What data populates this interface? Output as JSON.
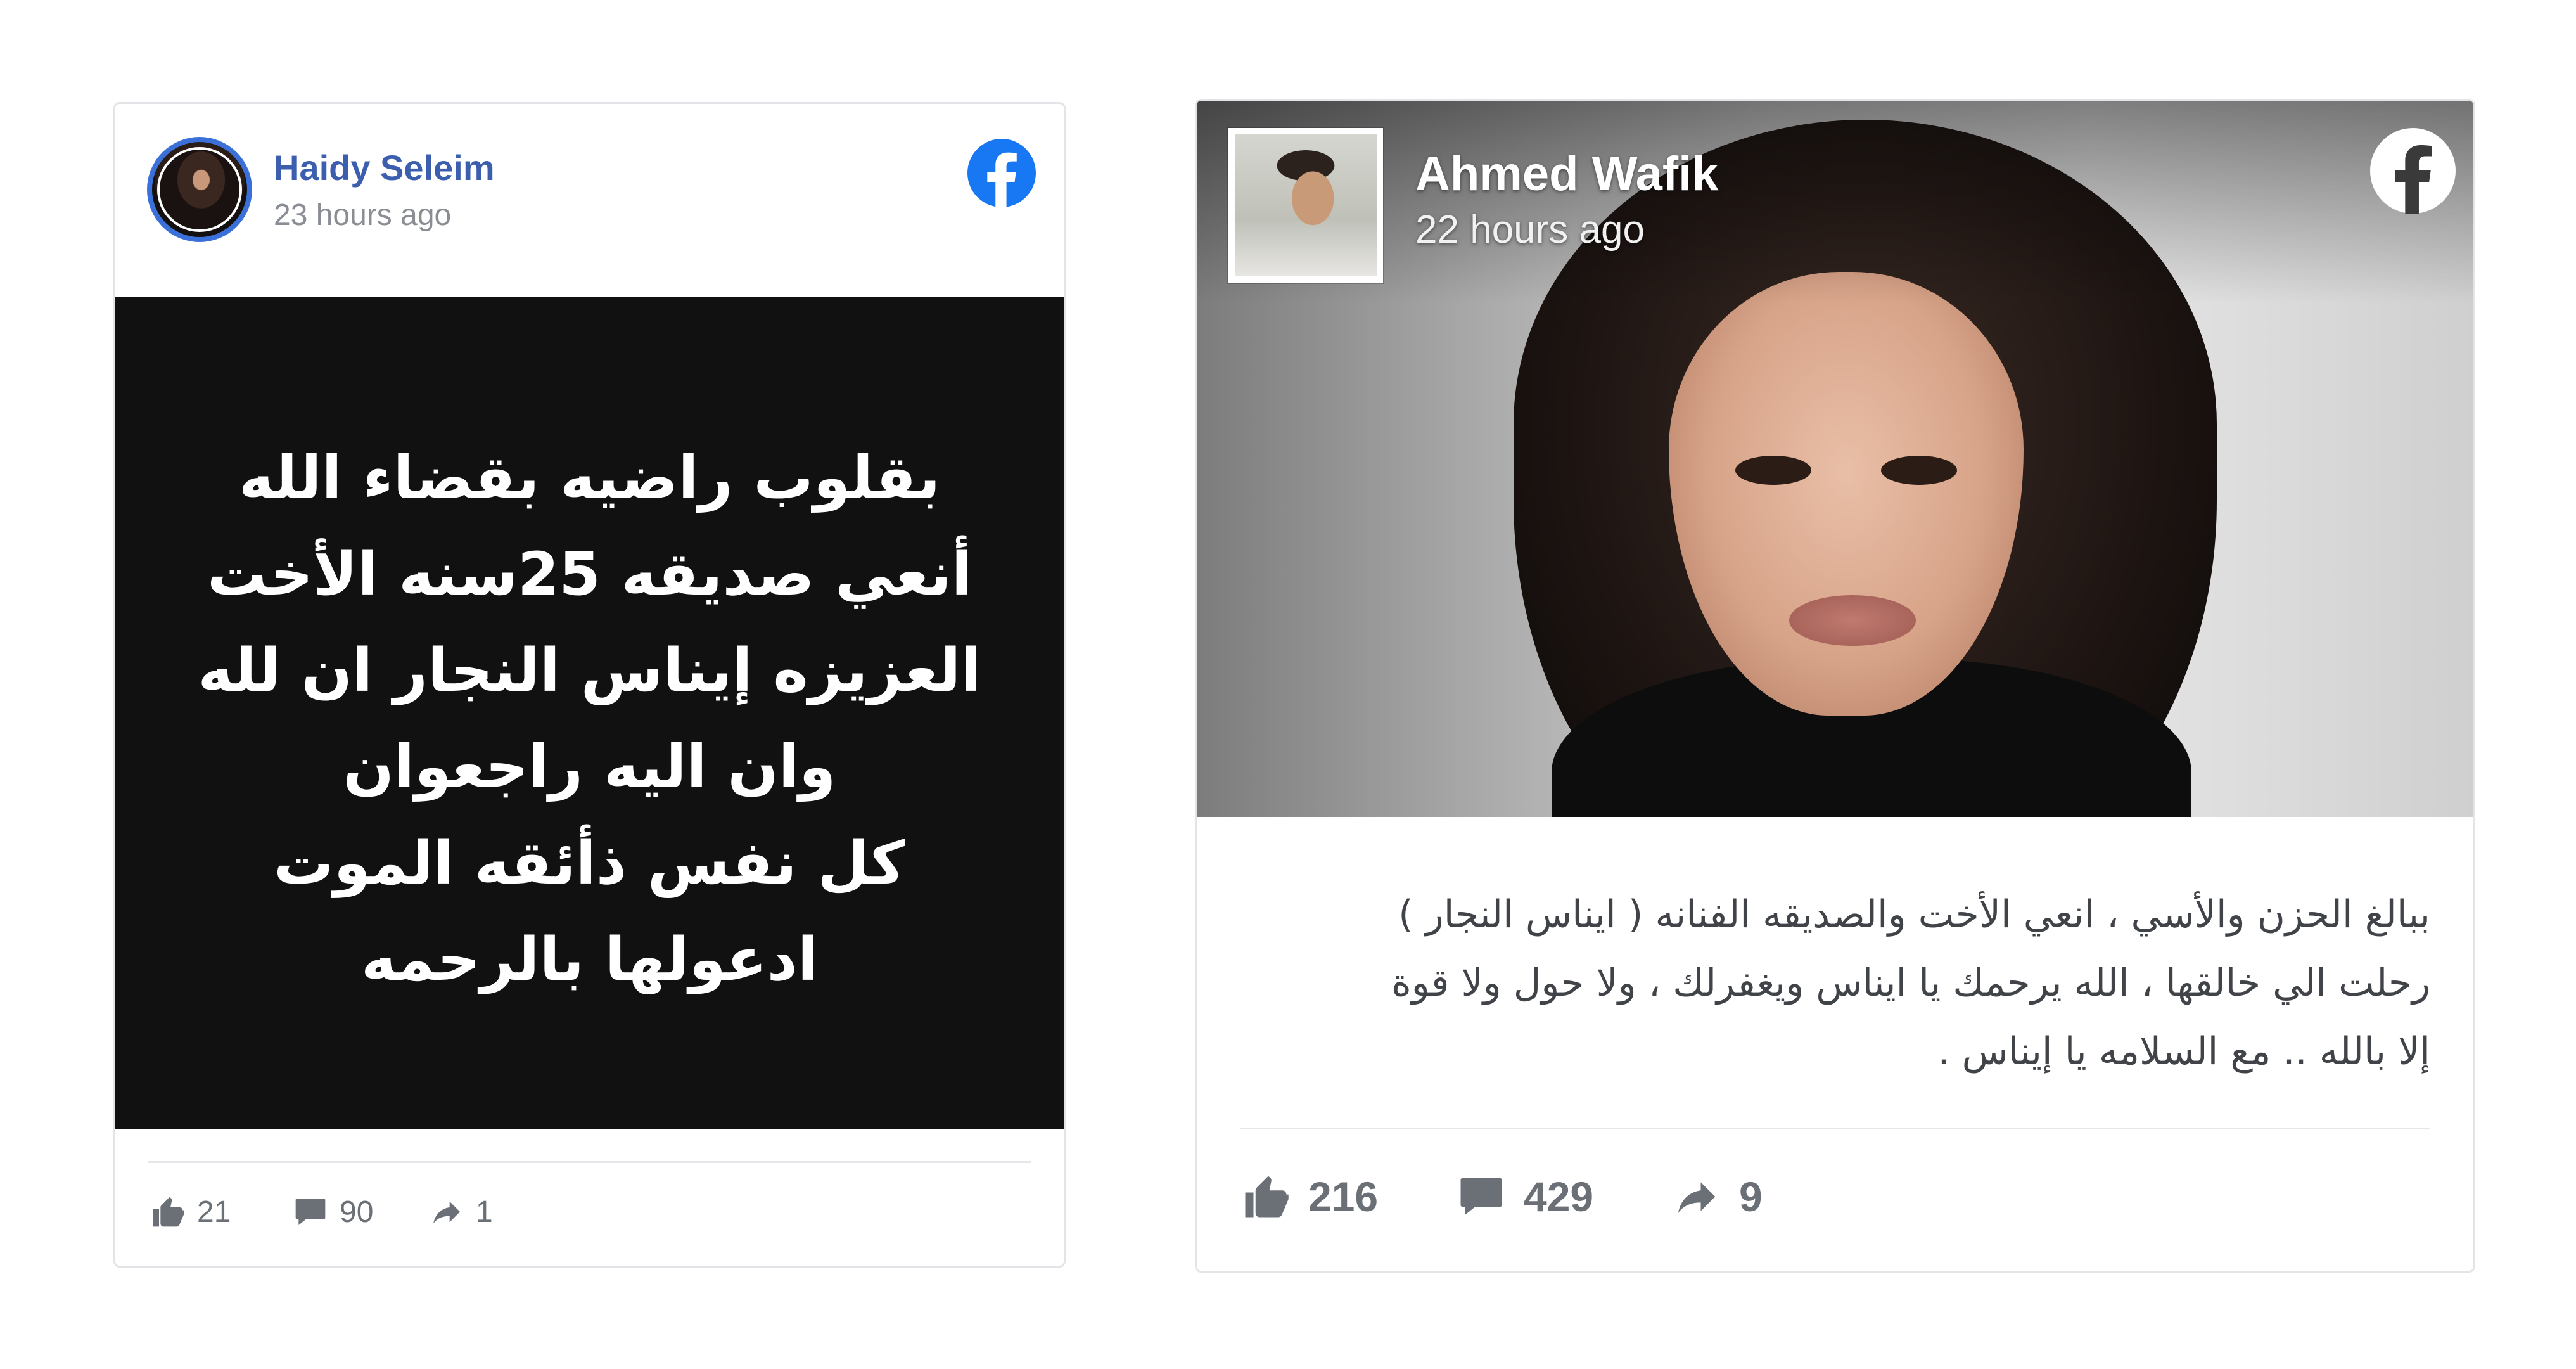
{
  "colors": {
    "facebook_blue": "#1877f2",
    "author_link": "#3b5fae",
    "muted_text": "#8a8d93",
    "post_bg_dark": "#111111"
  },
  "cards": [
    {
      "author": "Haidy Seleim",
      "time": "23 hours ago",
      "platform_icon": "facebook-icon",
      "post_lines": [
        "بقلوب راضيه بقضاء الله",
        "أنعي صديقه 25سنه الأخت",
        "العزيزه إيناس النجار ان لله",
        "وان اليه راجعوان",
        "كل نفس ذأئقه الموت",
        "ادعولها بالرحمه"
      ],
      "stats": {
        "likes": "21",
        "comments": "90",
        "shares": "1"
      }
    },
    {
      "author": "Ahmed Wafik",
      "time": "22 hours ago",
      "platform_icon": "facebook-icon",
      "post_lines": [
        "ببالغ الحزن والأسي ، انعي الأخت والصديقه الفنانه ( ايناس النجار )",
        "رحلت الي خالقها ، الله يرحمك يا ايناس ويغفرلك ، ولا حول ولا قوة",
        "إلا بالله .. مع السلامه يا إيناس ."
      ],
      "stats": {
        "likes": "216",
        "comments": "429",
        "shares": "9"
      }
    }
  ]
}
